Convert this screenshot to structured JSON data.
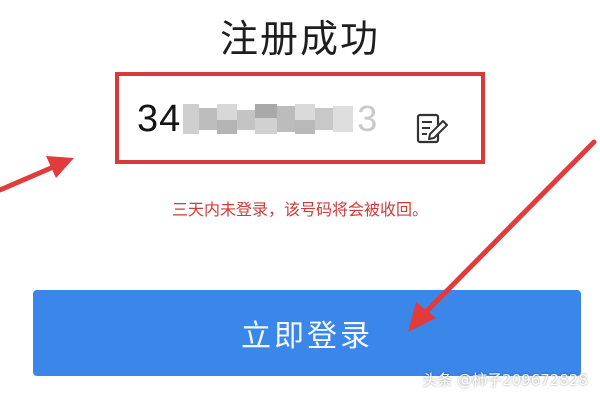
{
  "title": "注册成功",
  "account": {
    "number_visible": "34",
    "number_tail": "3",
    "edit_icon": "edit-note-icon"
  },
  "warning_text": "三天内未登录，该号码将会被收回。",
  "login_button_label": "立即登录",
  "watermark": "头条 @柿子209672828",
  "colors": {
    "accent_blue": "#3a86e9",
    "warning_red": "#cf3b3a",
    "frame_red": "#d9393b"
  }
}
